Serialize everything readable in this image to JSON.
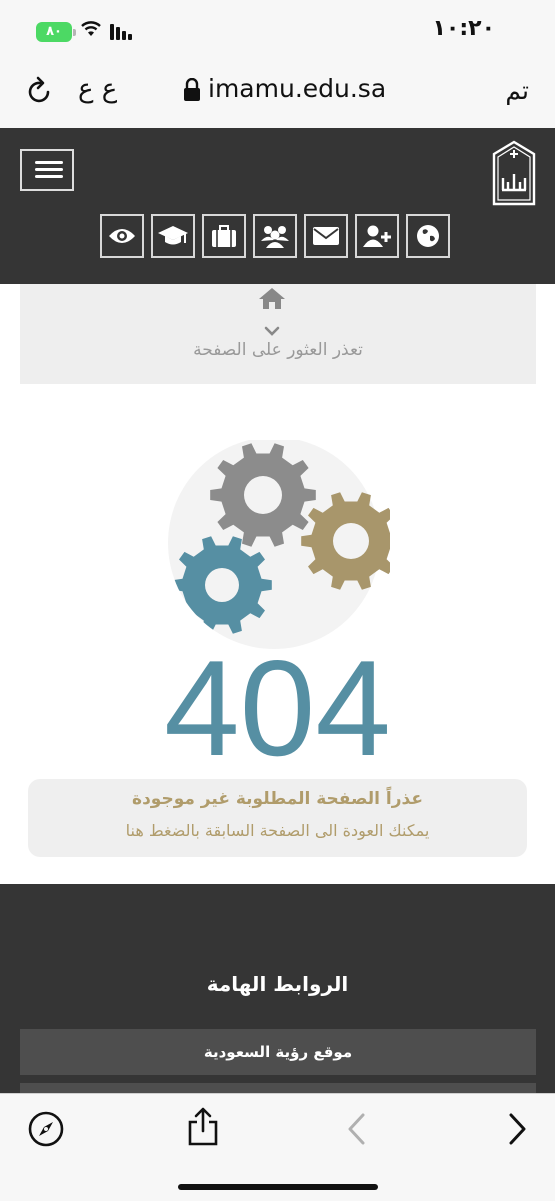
{
  "status_bar": {
    "time": "١٠:٢٠",
    "battery": "٨٠"
  },
  "address_bar": {
    "text_size": "ع ع",
    "url": "imamu.edu.sa",
    "done": "تم"
  },
  "breadcrumb": {
    "label": "تعذر العثور على الصفحة"
  },
  "error": {
    "code": "404",
    "title": "عذراً الصفحة المطلوبة غير موجودة",
    "subtitle": "يمكنك العودة الى الصفحة السابقة بالضغط هنا"
  },
  "footer": {
    "heading": "الروابط الهامة",
    "links": [
      "موقع رؤية السعودية"
    ]
  },
  "nav_icons": [
    "eye-icon",
    "graduation-cap-icon",
    "briefcase-icon",
    "users-icon",
    "envelope-icon",
    "add-user-icon",
    "globe-icon"
  ],
  "colors": {
    "header_bg": "#353535",
    "error_blue": "#568fa3",
    "gear_gray": "#8c8c8c",
    "gear_gold": "#a8966b",
    "message_gold": "#b09c6b"
  }
}
